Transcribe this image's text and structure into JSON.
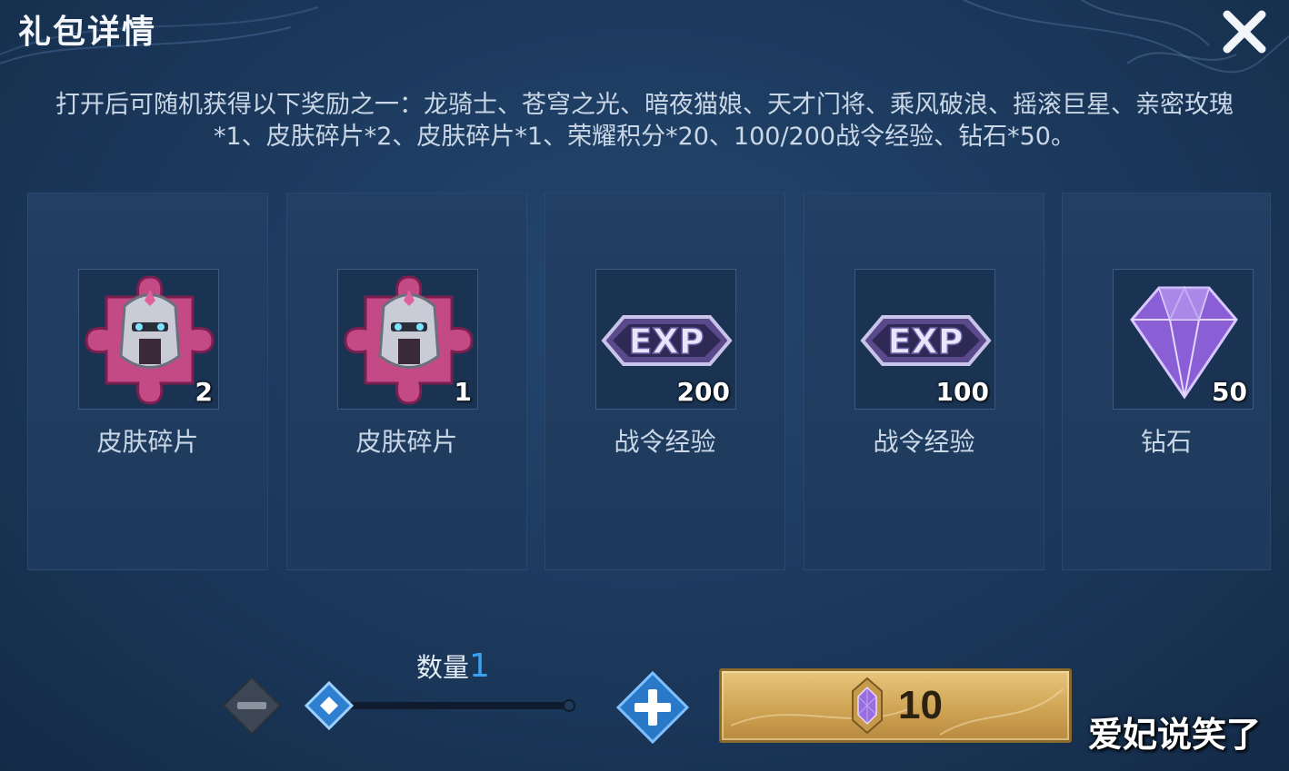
{
  "header": {
    "title": "礼包详情"
  },
  "description": "打开后可随机获得以下奖励之一：龙骑士、苍穹之光、暗夜猫娘、天才门将、乘风破浪、摇滚巨星、亲密玫瑰*1、皮肤碎片*2、皮肤碎片*1、荣耀积分*20、100/200战令经验、钻石*50。",
  "rewards": [
    {
      "name": "皮肤碎片",
      "count": "2",
      "icon": "skin-fragment-icon"
    },
    {
      "name": "皮肤碎片",
      "count": "1",
      "icon": "skin-fragment-icon"
    },
    {
      "name": "战令经验",
      "count": "200",
      "icon": "exp-icon"
    },
    {
      "name": "战令经验",
      "count": "100",
      "icon": "exp-icon"
    },
    {
      "name": "钻石",
      "count": "50",
      "icon": "diamond-icon"
    }
  ],
  "quantity": {
    "label": "数量",
    "value": "1"
  },
  "buy_button": {
    "price": "10",
    "icon": "crystal-coupon-icon"
  },
  "watermark": "爱妃说笑了",
  "colors": {
    "accent_blue": "#3aa0f0",
    "gold": "#d0a455",
    "panel": "#1f3b5e"
  }
}
